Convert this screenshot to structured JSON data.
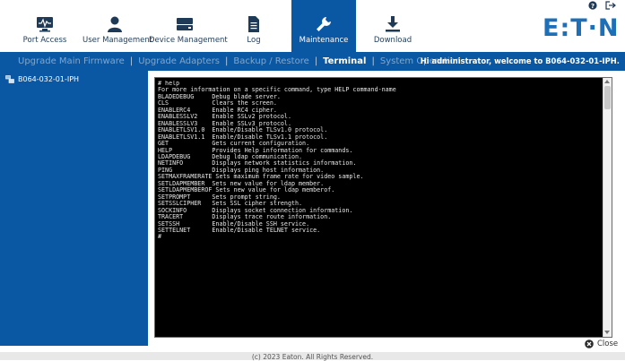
{
  "nav": {
    "items": [
      {
        "label": "Port Access",
        "icon": "port-access-icon"
      },
      {
        "label": "User Management",
        "icon": "user-icon"
      },
      {
        "label": "Device Management",
        "icon": "device-icon"
      },
      {
        "label": "Log",
        "icon": "log-icon"
      },
      {
        "label": "Maintenance",
        "icon": "wrench-icon",
        "active": true
      },
      {
        "label": "Download",
        "icon": "download-icon"
      }
    ],
    "logo": "E:T·N",
    "accent_color": "#0a58a4",
    "logo_color": "#1d70b8"
  },
  "subnav": {
    "tabs": [
      {
        "label": "Upgrade Main Firmware"
      },
      {
        "label": "Upgrade Adapters"
      },
      {
        "label": "Backup / Restore"
      },
      {
        "label": "Terminal",
        "active": true
      },
      {
        "label": "System Operation"
      }
    ],
    "separator": "|",
    "welcome": "Hi administrator, welcome to B064-032-01-IPH."
  },
  "sidebar": {
    "device_label": "B064-032-01-IPH"
  },
  "terminal": {
    "lines": [
      "# help",
      "For more information on a specific command, type HELP command-name",
      "BLADEDEBUG     Debug blade server.",
      "CLS            Clears the screen.",
      "ENABLERC4      Enable RC4 cipher.",
      "ENABLESSLV2    Enable SSLv2 protocol.",
      "ENABLESSLV3    Enable SSLv3 protocol.",
      "ENABLETLSV1.0  Enable/Disable TLSv1.0 protocol.",
      "ENABLETLSV1.1  Enable/Disable TLSv1.1 protocol.",
      "GET            Gets current configuration.",
      "HELP           Provides Help information for commands.",
      "LDAPDEBUG      Debug ldap communication.",
      "NETINFO        Displays network statistics information.",
      "PING           Displays ping host information.",
      "SETMAXFRAMERATE Sets maximum frame rate for video sample.",
      "SETLDAPMEMBER  Sets new value for ldap member.",
      "SETLDAPMEMBEROF Sets new value for ldap memberof.",
      "SETPROMPT      Sets prompt string.",
      "SETSSLCIPHER   Sets SSL cipher strength.",
      "SOCKINFO       Displays socket connection information.",
      "TRACERT        Displays trace route information.",
      "SETSSH         Enable/Disable SSH service.",
      "SETTELNET      Enable/Disable TELNET service.",
      "#"
    ]
  },
  "close_label": "Close",
  "footer": "(c) 2023 Eaton. All Rights Reserved."
}
